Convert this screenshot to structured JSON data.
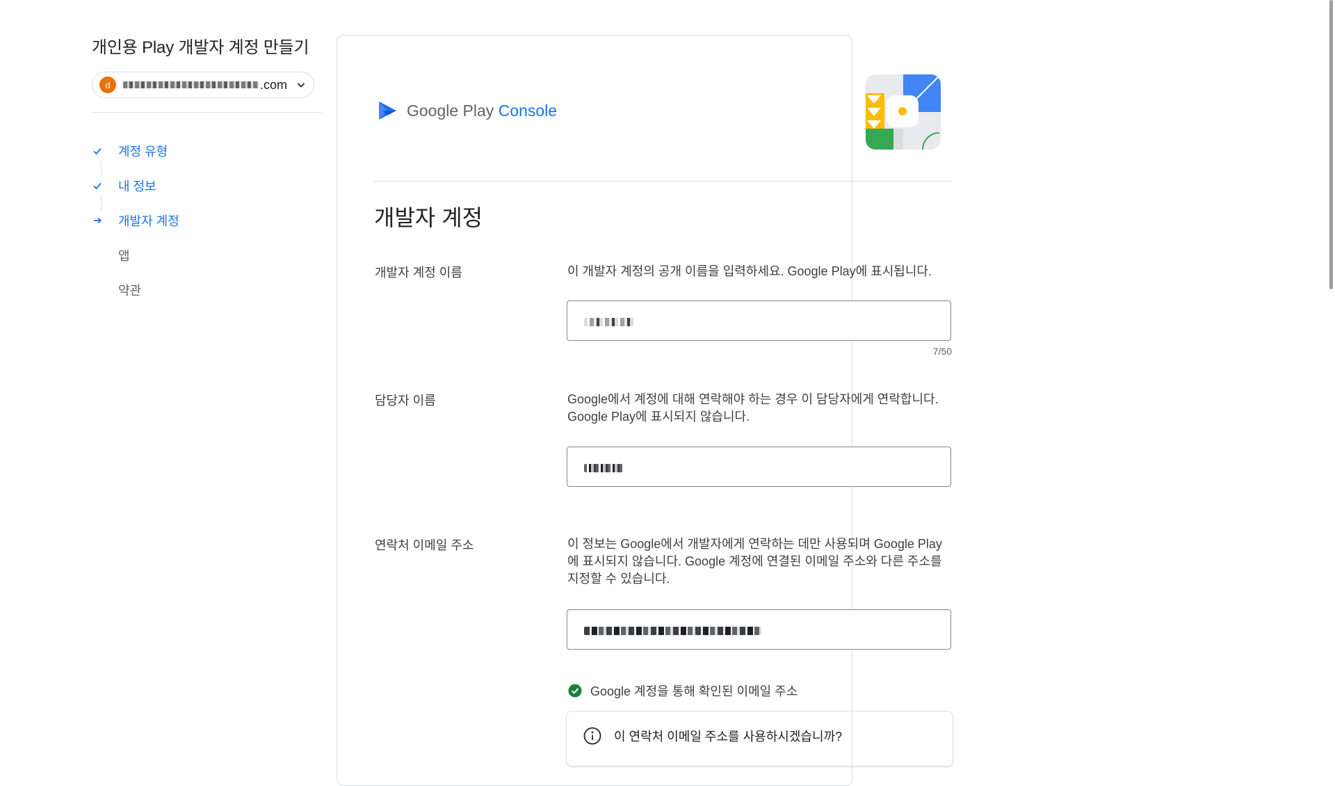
{
  "left_panel": {
    "page_title": "개인용 Play 개발자 계정 만들기",
    "account": {
      "avatar_letter": "d",
      "email_suffix": ".com",
      "icon": "chevron-down-icon"
    },
    "steps": [
      {
        "label": "계정 유형",
        "status": "done"
      },
      {
        "label": "내 정보",
        "status": "done"
      },
      {
        "label": "개발자 계정",
        "status": "current"
      },
      {
        "label": "앱",
        "status": "todo"
      },
      {
        "label": "약관",
        "status": "todo"
      }
    ]
  },
  "card": {
    "brand": {
      "name": "Google Play",
      "product": "Console"
    },
    "section_title": "개발자 계정",
    "fields": {
      "developer_name": {
        "label": "개발자 계정 이름",
        "description": "이 개발자 계정의 공개 이름을 입력하세요. Google Play에 표시됩니다.",
        "counter": "7/50"
      },
      "contact_name": {
        "label": "담당자 이름",
        "description": "Google에서 계정에 대해 연락해야 하는 경우 이 담당자에게 연락합니다. Google Play에 표시되지 않습니다."
      },
      "contact_email": {
        "label": "연락처 이메일 주소",
        "description": "이 정보는 Google에서 개발자에게 연락하는 데만 사용되며 Google Play에 표시되지 않습니다. Google 계정에 연결된 이메일 주소와 다른 주소를 지정할 수 있습니다.",
        "verified_text": "Google 계정을 통해 확인된 이메일 주소"
      }
    },
    "info_box": {
      "text": "이 연락처 이메일 주소를 사용하시겠습니까?"
    }
  },
  "colors": {
    "accent": "#1a73e8",
    "verified": "#188038",
    "avatar": "#e8710a"
  }
}
